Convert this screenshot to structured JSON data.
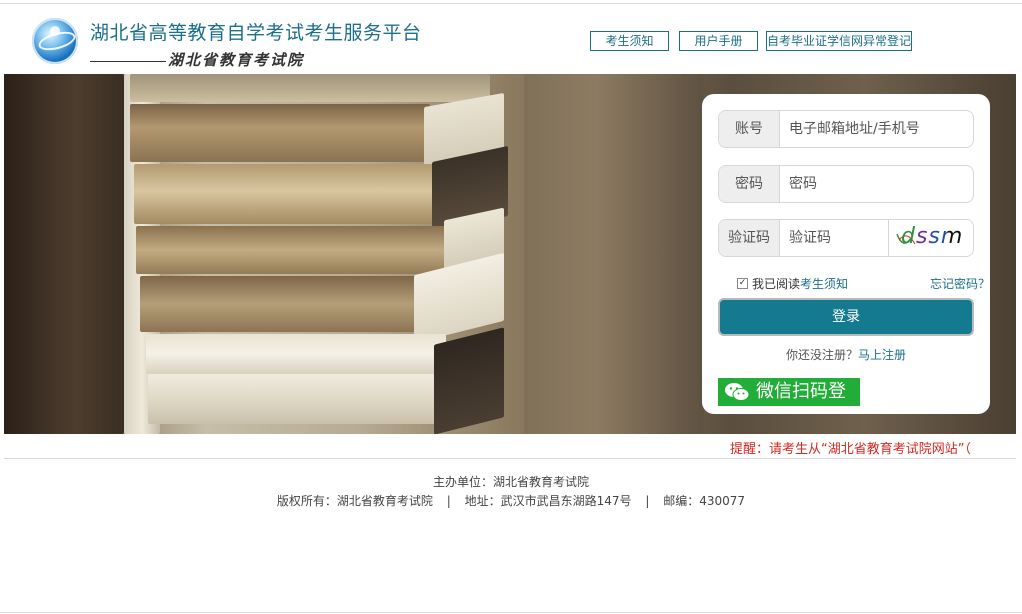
{
  "header": {
    "title": "湖北省高等教育自学考试考生服务平台",
    "subtitle": "湖北省教育考试院",
    "links": [
      "考生须知",
      "用户手册",
      "自考毕业证学信网异常登记"
    ]
  },
  "login": {
    "account_label": "账号",
    "account_placeholder": "电子邮箱地址/手机号",
    "password_label": "密码",
    "password_placeholder": "密码",
    "captcha_label": "验证码",
    "captcha_placeholder": "验证码",
    "captcha_text": "dssm",
    "agree_prefix": "我已阅读",
    "agree_link": "考生须知",
    "agree_checked": true,
    "forgot": "忘记密码？",
    "login_button": "登录",
    "register_prompt": "你还没注册？",
    "register_link": "马上注册",
    "wechat_label": "微信扫码登"
  },
  "notice": "提醒：请考生从“湖北省教育考试院网站”（",
  "footer": {
    "host": "主办单位：湖北省教育考试院",
    "copyright": "版权所有：湖北省教育考试院",
    "address": "地址：武汉市武昌东湖路147号",
    "postcode": "邮编：430077"
  },
  "colors": {
    "accent": "#1c6f8a",
    "login_button": "#147a8f",
    "wechat": "#22ac38",
    "notice": "#d4281f"
  }
}
